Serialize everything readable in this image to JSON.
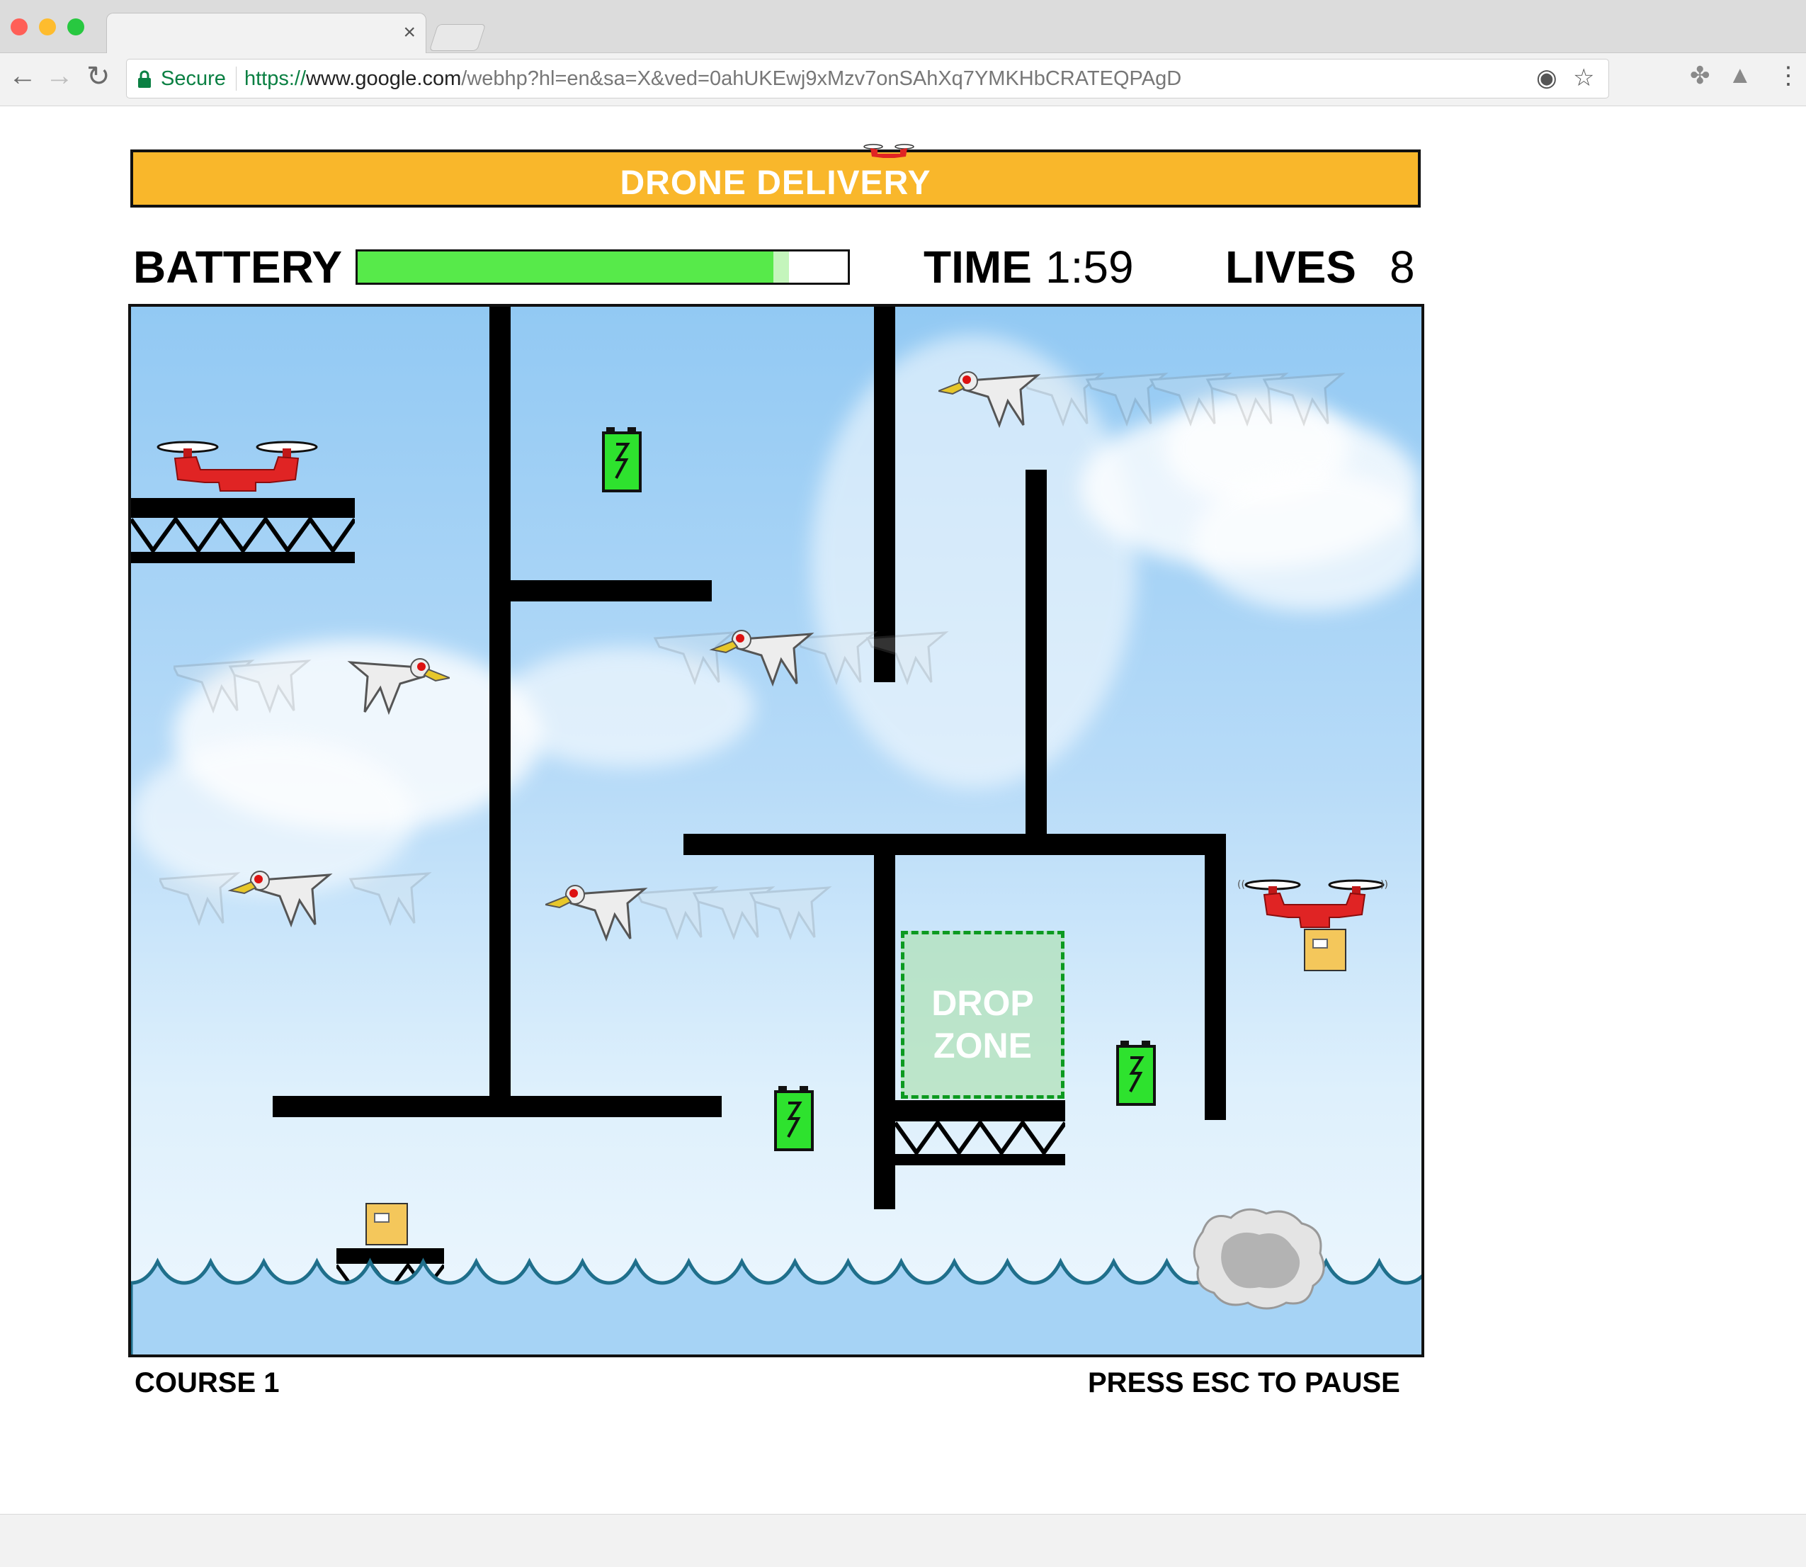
{
  "browser": {
    "tab_close": "×",
    "secure_label": "Secure",
    "url_scheme": "https://",
    "url_host": "www.google.com",
    "url_path": "/webhp?hl=en&sa=X&ved=0ahUKEwj9xMzv7onSAhXq7YMKHbCRATEQPAgD",
    "traffic_light_colors": [
      "#ff5f57",
      "#febc2e",
      "#28c840"
    ]
  },
  "game": {
    "title": "DRONE DELIVERY",
    "hud": {
      "battery_label": "BATTERY",
      "battery_level": 0.88,
      "time_label": "TIME",
      "time_value": "1:59",
      "lives_label": "LIVES",
      "lives_value": "8"
    },
    "drop_zone": {
      "line1": "DROP",
      "line2": "ZONE"
    },
    "course_label": "COURSE 1",
    "pause_hint": "PRESS ESC TO PAUSE",
    "colors": {
      "banner": "#f9b72b",
      "battery_fill": "#57ea4a",
      "drone": "#e02424",
      "drop_zone_border": "#0c9a20",
      "water": "#a6d3f5",
      "wave_line": "#1f6f8b"
    }
  }
}
